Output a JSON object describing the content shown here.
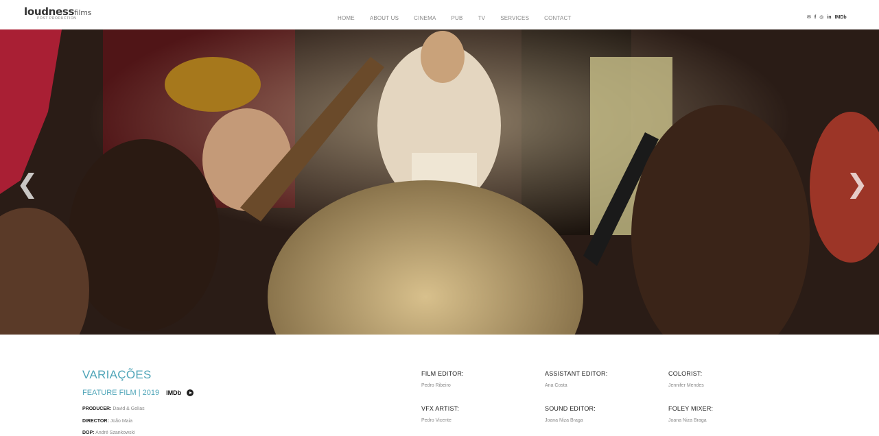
{
  "brand": {
    "name_bold": "loudness",
    "name_light": "films",
    "tagline": "POST PRODUCTION"
  },
  "nav": [
    "HOME",
    "ABOUT US",
    "CINEMA",
    "PUB",
    "TV",
    "SERVICES",
    "CONTACT"
  ],
  "social": {
    "imdb": "IMDb"
  },
  "slider": {
    "prev": "❮",
    "next": "❯"
  },
  "film": {
    "title": "VARIAÇÕES",
    "subtitle": "FEATURE FILM | 2019",
    "imdb": "IMDb",
    "credits": [
      {
        "label": "PRODUCER:",
        "value": "David & Golias"
      },
      {
        "label": "DIRECTOR:",
        "value": "João Maia"
      },
      {
        "label": "DOP:",
        "value": "André Szankowski"
      }
    ]
  },
  "crew": [
    {
      "role": "FILM EDITOR:",
      "name": "Pedro Ribeiro"
    },
    {
      "role": "ASSISTANT EDITOR:",
      "name": "Ana Costa"
    },
    {
      "role": "COLORIST:",
      "name": "Jennifer Mendes"
    },
    {
      "role": "VFX ARTIST:",
      "name": "Pedro Vicente"
    },
    {
      "role": "SOUND EDITOR:",
      "name": "Joana Niza Braga"
    },
    {
      "role": "FOLEY MIXER:",
      "name": "Joana Niza Braga"
    }
  ]
}
